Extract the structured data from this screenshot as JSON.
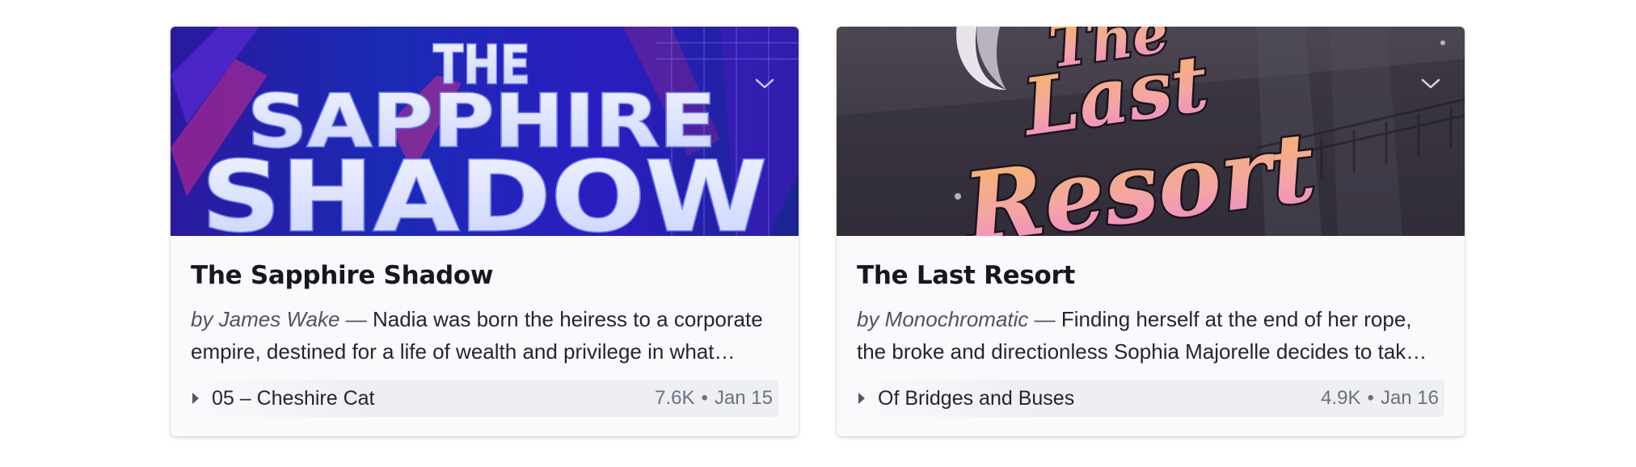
{
  "cards": [
    {
      "cover_text": [
        "THE",
        "SAPPHIRE",
        "SHADOW"
      ],
      "title": "The Sapphire Shadow",
      "author": "by James Wake",
      "separator": "—",
      "description": "Nadia was born the heiress to a corporate empire, destined for a life of wealth and privilege in what…",
      "episode": {
        "title": "05 – Cheshire Cat",
        "plays": "7.6K",
        "dot": "•",
        "date": "Jan 15"
      }
    },
    {
      "cover_text": [
        "The",
        "Last",
        "Resort"
      ],
      "title": "The Last Resort",
      "author": "by Monochromatic",
      "separator": "—",
      "description": "Finding herself at the end of her rope, the broke and directionless Sophia Majorelle decides to tak…",
      "episode": {
        "title": "Of Bridges and Buses",
        "plays": "4.9K",
        "dot": "•",
        "date": "Jan 16"
      }
    }
  ],
  "icons": {
    "dropdown": "chevron-down-icon",
    "play": "play-triangle-icon"
  },
  "colors": {
    "card_bg": "#fafafc",
    "title": "#161821",
    "meta": "#6d7080",
    "cover1_bg": "#1c1aa6",
    "cover2_bg": "#3a3640",
    "cover2_text_top": "#f4b86c",
    "cover2_text_bottom": "#f08cc8"
  }
}
